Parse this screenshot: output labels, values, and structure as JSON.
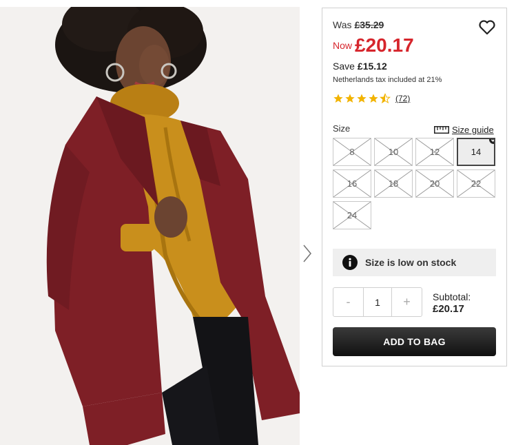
{
  "product": {
    "image_alt": "Woman wearing burgundy boucle coat over mustard cable knit turtleneck",
    "colors": {
      "coat": "#7e1f26",
      "sweater": "#c98f1c",
      "sale_red": "#d6252c",
      "button_dark": "#222222"
    }
  },
  "pricing": {
    "was_label": "Was",
    "was_price": "£35.29",
    "now_label": "Now",
    "now_price": "£20.17",
    "save_label": "Save",
    "save_amount": "£15.12",
    "tax_note": "Netherlands tax included at 21%"
  },
  "rating": {
    "stars": 4.5,
    "review_count": "(72)"
  },
  "size": {
    "label": "Size",
    "guide_label": "Size guide",
    "options": [
      {
        "label": "8",
        "available": false,
        "selected": false
      },
      {
        "label": "10",
        "available": false,
        "selected": false
      },
      {
        "label": "12",
        "available": false,
        "selected": false
      },
      {
        "label": "14",
        "available": true,
        "selected": true
      },
      {
        "label": "16",
        "available": false,
        "selected": false
      },
      {
        "label": "18",
        "available": false,
        "selected": false
      },
      {
        "label": "20",
        "available": false,
        "selected": false
      },
      {
        "label": "22",
        "available": false,
        "selected": false
      },
      {
        "label": "24",
        "available": false,
        "selected": false
      }
    ]
  },
  "stock": {
    "message": "Size is low on stock"
  },
  "quantity": {
    "minus": "-",
    "value": "1",
    "plus": "+"
  },
  "subtotal": {
    "label": "Subtotal:",
    "value": "£20.17"
  },
  "cta": {
    "add_to_bag": "ADD TO BAG"
  },
  "icons": {
    "wishlist": "heart-outline-icon",
    "next": "chevron-right-icon",
    "info": "info-circle-icon",
    "ruler": "ruler-icon",
    "star": "star-icon",
    "check": "check-circle-icon"
  }
}
